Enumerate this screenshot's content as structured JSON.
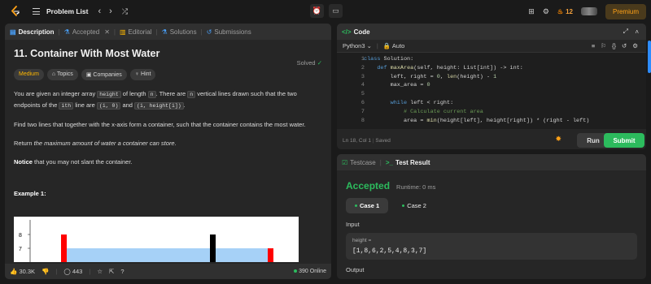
{
  "topbar": {
    "title": "Problem List",
    "streak_count": "12",
    "premium_label": "Premium"
  },
  "left_tabs": [
    {
      "label": "Description",
      "icon": "document-icon"
    },
    {
      "label": "Accepted",
      "icon": "flask-icon"
    },
    {
      "label": "Editorial",
      "icon": "book-icon"
    },
    {
      "label": "Solutions",
      "icon": "beaker-icon"
    },
    {
      "label": "Submissions",
      "icon": "history-icon"
    }
  ],
  "problem": {
    "title": "11. Container With Most Water",
    "status": "Solved",
    "chips": {
      "difficulty": "Medium",
      "topics": "Topics",
      "companies": "Companies",
      "hint": "Hint"
    },
    "p1_a": "You are given an integer array ",
    "p1_code1": "height",
    "p1_b": " of length ",
    "p1_code2": "n",
    "p1_c": ". There are ",
    "p1_code3": "n",
    "p1_d": " vertical lines drawn such that the two endpoints of the ",
    "p1_code4": "ith",
    "p1_e": " line are ",
    "p1_code5": "(i, 0)",
    "p1_f": " and ",
    "p1_code6": "(i, height[i])",
    "p1_g": ".",
    "p2": "Find two lines that together with the x-axis form a container, such that the container contains the most water.",
    "p3_a": "Return ",
    "p3_b": "the maximum amount of water a container can store",
    "p3_c": ".",
    "p4_a": "Notice",
    "p4_b": " that you may not slant the container.",
    "example_title": "Example 1:"
  },
  "chart_data": {
    "type": "bar",
    "y_ticks": [
      "8",
      "7"
    ],
    "visible_heights": [
      8,
      7,
      8,
      7
    ],
    "colors": {
      "red": "#ff0000",
      "black": "#000000",
      "water": "#a6d1f7"
    }
  },
  "footer": {
    "likes": "30.3K",
    "comments": "443",
    "online": "390 Online"
  },
  "code_panel": {
    "title": "Code",
    "language": "Python3",
    "auto": "Auto",
    "lines": [
      {
        "n": "1",
        "t": "class Solution:"
      },
      {
        "n": "2",
        "t": "    def maxArea(self, height: List[int]) -> int:"
      },
      {
        "n": "3",
        "t": "        left, right = 0, len(height) - 1"
      },
      {
        "n": "4",
        "t": "        max_area = 0"
      },
      {
        "n": "5",
        "t": ""
      },
      {
        "n": "6",
        "t": "        while left < right:"
      },
      {
        "n": "7",
        "t": "            # Calculate current area"
      },
      {
        "n": "8",
        "t": "            area = min(height[left], height[right]) * (right - left)"
      }
    ],
    "status": "Ln 18, Col 1",
    "saved": "Saved",
    "run": "Run",
    "submit": "Submit"
  },
  "result_panel": {
    "tab_testcase": "Testcase",
    "tab_result": "Test Result",
    "verdict": "Accepted",
    "runtime": "Runtime: 0 ms",
    "case1": "Case 1",
    "case2": "Case 2",
    "input_label": "Input",
    "var_name": "height =",
    "var_value": "[1,8,6,2,5,4,8,3,7]",
    "output_label": "Output"
  }
}
